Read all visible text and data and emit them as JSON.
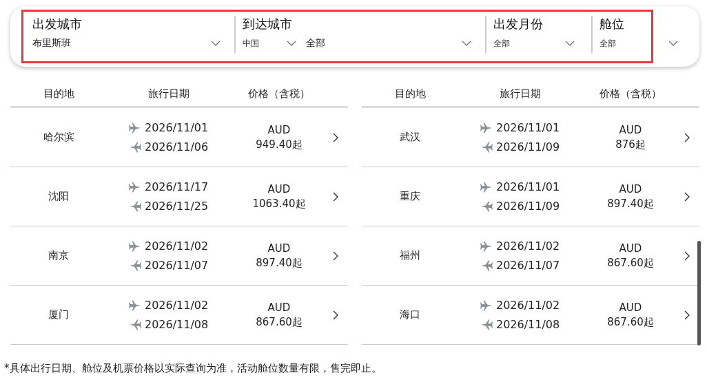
{
  "filters": [
    {
      "label": "出发城市",
      "selects": [
        {
          "value": "布里斯班",
          "kind": "wide"
        }
      ]
    },
    {
      "label": "到达城市",
      "selects": [
        {
          "value": "中国",
          "kind": "compact"
        },
        {
          "value": "全部",
          "kind": "wide"
        }
      ]
    },
    {
      "label": "出发月份",
      "selects": [
        {
          "value": "全部",
          "kind": "compact"
        }
      ]
    },
    {
      "label": "舱位",
      "selects": [
        {
          "value": "全部",
          "kind": "compact"
        }
      ]
    }
  ],
  "tables": [
    {
      "columns": [
        "目的地",
        "旅行日期",
        "价格（含税）"
      ],
      "rows": [
        {
          "destination": "哈尔滨",
          "outbound": "2026/11/01",
          "return": "2026/11/06",
          "currency": "AUD",
          "price": "949.40起"
        },
        {
          "destination": "沈阳",
          "outbound": "2026/11/17",
          "return": "2026/11/25",
          "currency": "AUD",
          "price": "1063.40起"
        },
        {
          "destination": "南京",
          "outbound": "2026/11/02",
          "return": "2026/11/07",
          "currency": "AUD",
          "price": "897.40起"
        },
        {
          "destination": "厦门",
          "outbound": "2026/11/02",
          "return": "2026/11/08",
          "currency": "AUD",
          "price": "867.60起"
        }
      ]
    },
    {
      "columns": [
        "目的地",
        "旅行日期",
        "价格（含税）"
      ],
      "rows": [
        {
          "destination": "武汉",
          "outbound": "2026/11/01",
          "return": "2026/11/09",
          "currency": "AUD",
          "price": "876起"
        },
        {
          "destination": "重庆",
          "outbound": "2026/11/01",
          "return": "2026/11/09",
          "currency": "AUD",
          "price": "897.40起"
        },
        {
          "destination": "福州",
          "outbound": "2026/11/02",
          "return": "2026/11/07",
          "currency": "AUD",
          "price": "867.60起"
        },
        {
          "destination": "海口",
          "outbound": "2026/11/02",
          "return": "2026/11/08",
          "currency": "AUD",
          "price": "867.60起"
        }
      ]
    }
  ],
  "note": "*具体出行日期、舱位及机票价格以实际查询为准，活动舱位数量有限，售完即止。"
}
